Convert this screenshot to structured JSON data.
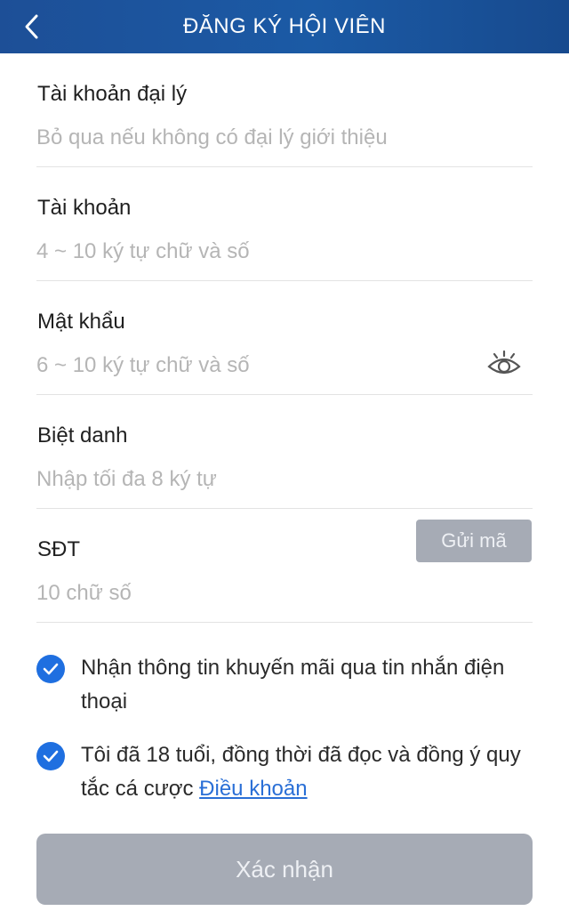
{
  "header": {
    "title": "ĐĂNG KÝ HỘI VIÊN",
    "back_icon": "chevron-left-icon"
  },
  "fields": [
    {
      "label": "Tài khoản đại lý",
      "placeholder": "Bỏ qua nếu không có đại lý giới thiệu",
      "value": ""
    },
    {
      "label": "Tài khoản",
      "placeholder": "4 ~ 10 ký tự chữ và số",
      "value": ""
    },
    {
      "label": "Mật khẩu",
      "placeholder": "6 ~ 10 ký tự chữ và số",
      "value": "",
      "icon": "eye-icon"
    },
    {
      "label": "Biệt danh",
      "placeholder": "Nhập tối đa 8 ký tự",
      "value": ""
    },
    {
      "label": "SĐT",
      "placeholder": "10 chữ số",
      "value": ""
    }
  ],
  "send_code_label": "Gửi mã",
  "checkboxes": [
    {
      "text": "Nhận thông tin khuyến mãi qua tin nhắn điện thoại",
      "checked": true
    },
    {
      "text": "Tôi đã 18 tuổi, đồng thời đã đọc và đồng ý quy tắc cá cược ",
      "link": "Điều khoản",
      "checked": true
    }
  ],
  "confirm_label": "Xác nhận",
  "colors": {
    "header": "#1b5aa5",
    "check": "#1f6fe0",
    "link": "#2a6fd6",
    "button_disabled": "#a6abb5"
  }
}
